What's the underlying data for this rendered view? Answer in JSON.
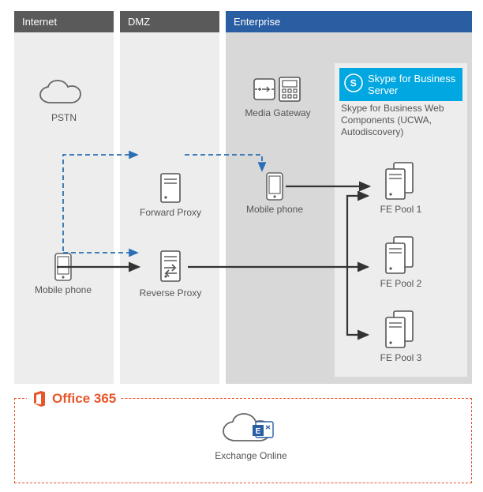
{
  "zones": {
    "internet": "Internet",
    "dmz": "DMZ",
    "enterprise": "Enterprise"
  },
  "nodes": {
    "pstn": "PSTN",
    "mobile_ext": "Mobile phone",
    "fwd_proxy": "Forward Proxy",
    "rev_proxy": "Reverse Proxy",
    "media_gw": "Media Gateway",
    "mobile_int": "Mobile phone",
    "fe1": "FE Pool 1",
    "fe2": "FE Pool 2",
    "fe3": "FE Pool 3",
    "exchange": "Exchange Online"
  },
  "sfb": {
    "title_line1": "Skype for Business",
    "title_line2": "Server",
    "sub": "Skype for Business Web Components (UCWA, Autodiscovery)"
  },
  "office365": "Office 365"
}
